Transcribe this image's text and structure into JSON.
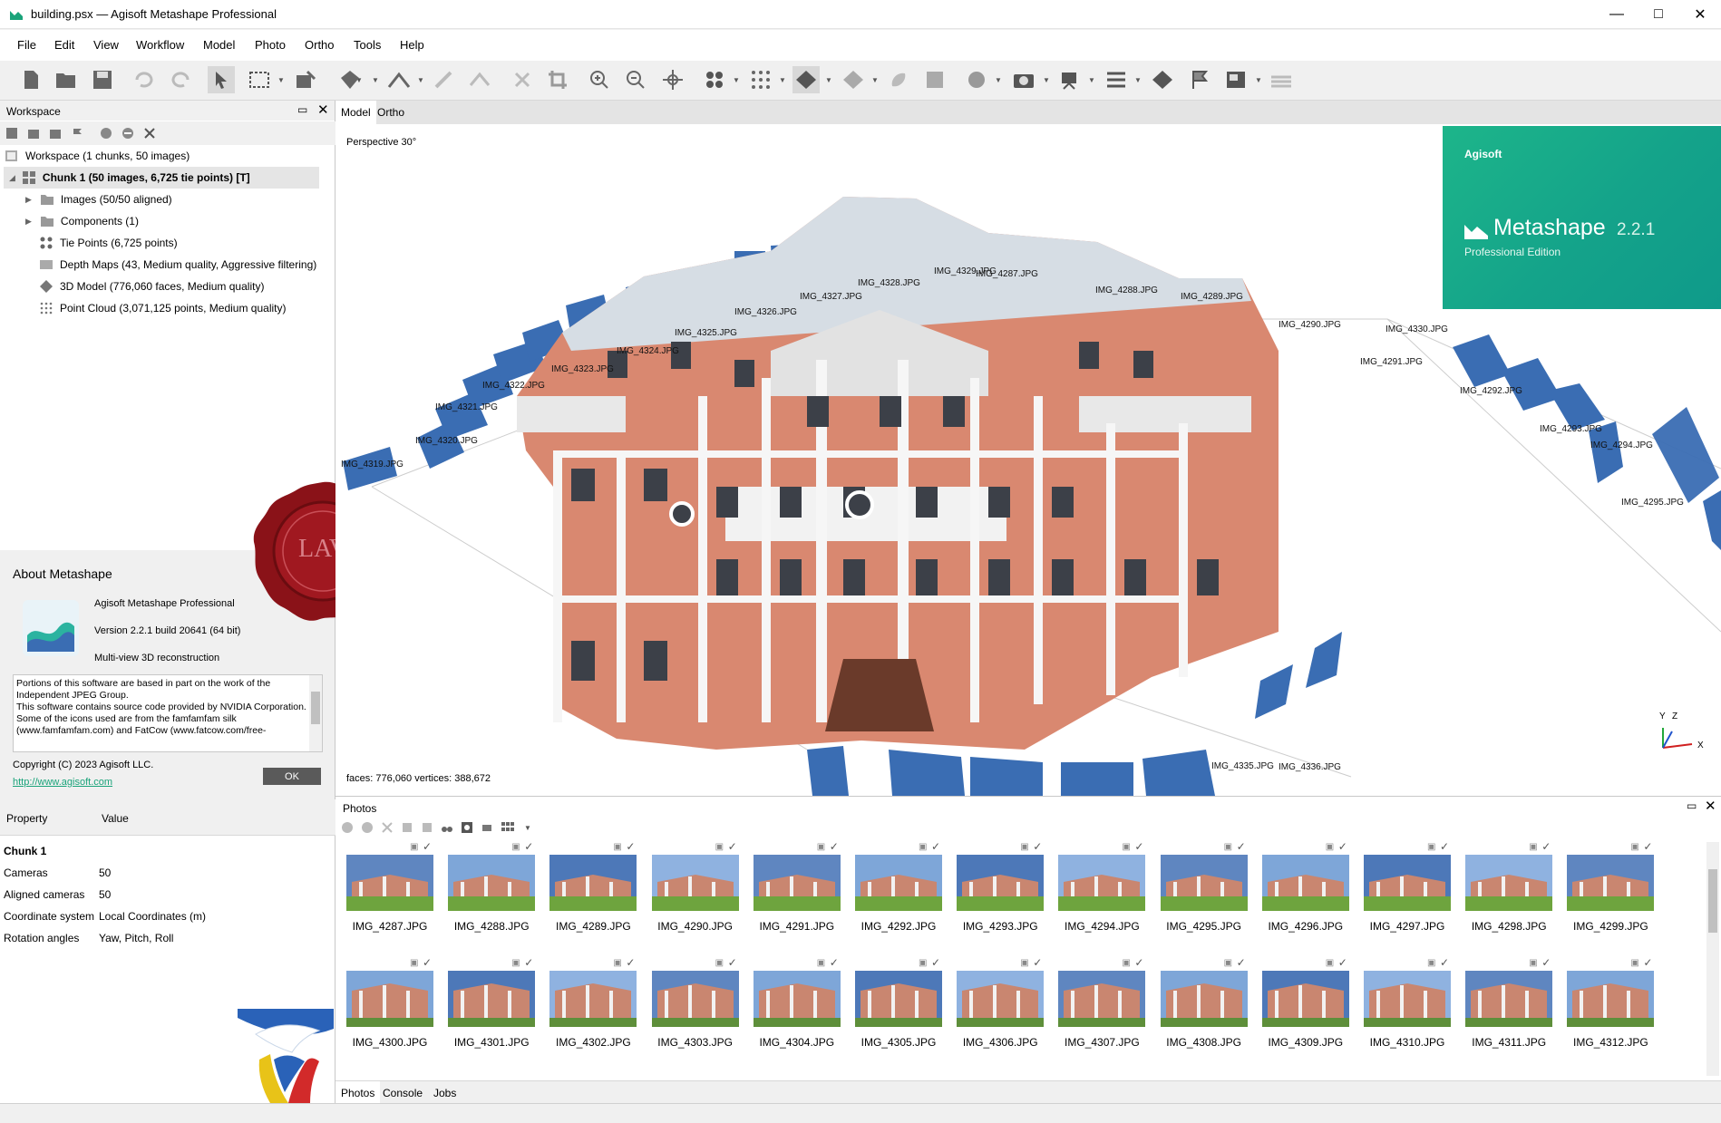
{
  "window": {
    "title": "building.psx — Agisoft Metashape Professional"
  },
  "menu": [
    "File",
    "Edit",
    "View",
    "Workflow",
    "Model",
    "Photo",
    "Ortho",
    "Tools",
    "Help"
  ],
  "workspace": {
    "title": "Workspace",
    "root": "Workspace (1 chunks, 50 images)",
    "chunk": "Chunk 1 (50 images, 6,725 tie points) [T]",
    "items": [
      "Images (50/50 aligned)",
      "Components (1)",
      "Tie Points (6,725 points)",
      "Depth Maps (43, Medium quality, Aggressive filtering)",
      "3D Model (776,060 faces, Medium quality)",
      "Point Cloud (3,071,125 points, Medium quality)"
    ]
  },
  "about": {
    "title": "About Metashape",
    "product": "Agisoft Metashape Professional",
    "version": "Version 2.2.1 build 20641 (64 bit)",
    "tagline": "Multi-view 3D reconstruction",
    "credits": "Portions of this software are based in part on the work of the Independent JPEG Group.\nThis software contains source code provided by NVIDIA Corporation.\nSome of the icons used are from the famfamfam silk (www.famfamfam.com) and FatCow (www.fatcow.com/free-",
    "copyright": "Copyright (C) 2023 Agisoft LLC.",
    "link": "http://www.agisoft.com",
    "ok": "OK"
  },
  "props": {
    "headers": [
      "Property",
      "Value"
    ],
    "group": "Chunk 1",
    "rows": [
      [
        "Cameras",
        "50"
      ],
      [
        "Aligned cameras",
        "50"
      ],
      [
        "Coordinate system",
        "Local Coordinates (m)"
      ],
      [
        "Rotation angles",
        "Yaw, Pitch, Roll"
      ]
    ]
  },
  "view": {
    "tabs": [
      "Model",
      "Ortho"
    ],
    "mode": "Perspective 30°",
    "stats": "faces: 776,060 vertices: 388,672",
    "axes": {
      "y": "Y",
      "z": "Z",
      "x": "X"
    },
    "cameras": [
      "IMG_4319.JPG",
      "IMG_4320.JPG",
      "IMG_4321.JPG",
      "IMG_4322.JPG",
      "IMG_4323.JPG",
      "IMG_4324.JPG",
      "IMG_4325.JPG",
      "IMG_4326.JPG",
      "IMG_4327.JPG",
      "IMG_4328.JPG",
      "IMG_4329.JPG",
      "IMG_4287.JPG",
      "IMG_4288.JPG",
      "IMG_4289.JPG",
      "IMG_4290.JPG",
      "IMG_4330.JPG",
      "IMG_4291.JPG",
      "IMG_4292.JPG",
      "IMG_4293.JPG",
      "IMG_4294.JPG",
      "IMG_4295.JPG",
      "IMG_4335.JPG",
      "IMG_4336.JPG"
    ]
  },
  "splash": {
    "brand": "Agisoft",
    "product": "Metashape",
    "version": "2.2.1",
    "edition": "Professional Edition"
  },
  "seal": "LAV",
  "photos": {
    "title": "Photos",
    "row1": [
      "IMG_4287.JPG",
      "IMG_4288.JPG",
      "IMG_4289.JPG",
      "IMG_4290.JPG",
      "IMG_4291.JPG",
      "IMG_4292.JPG",
      "IMG_4293.JPG",
      "IMG_4294.JPG",
      "IMG_4295.JPG",
      "IMG_4296.JPG",
      "IMG_4297.JPG",
      "IMG_4298.JPG",
      "IMG_4299.JPG"
    ],
    "row2": [
      "IMG_4300.JPG",
      "IMG_4301.JPG",
      "IMG_4302.JPG",
      "IMG_4303.JPG",
      "IMG_4304.JPG",
      "IMG_4305.JPG",
      "IMG_4306.JPG",
      "IMG_4307.JPG",
      "IMG_4308.JPG",
      "IMG_4309.JPG",
      "IMG_4310.JPG",
      "IMG_4311.JPG",
      "IMG_4312.JPG"
    ],
    "bottomTabs": [
      "Photos",
      "Console",
      "Jobs"
    ]
  },
  "colors": {
    "accent": "#1aa37a",
    "camera": "#3a6db3",
    "facade": "#d9826a",
    "seal": "#8a1218"
  }
}
